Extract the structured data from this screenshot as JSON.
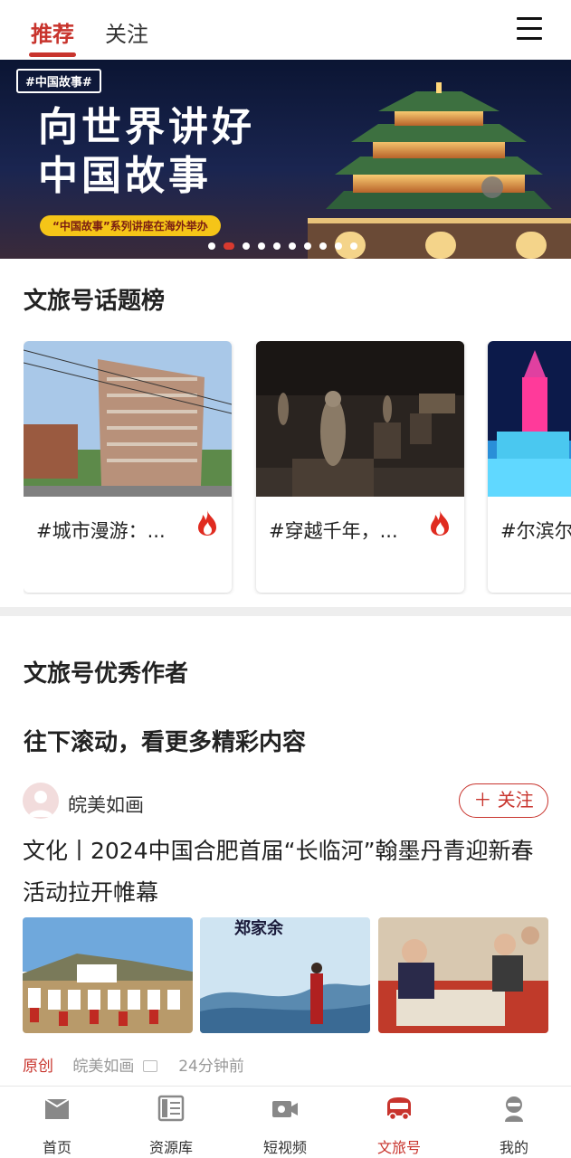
{
  "tabs": [
    {
      "label": "推荐",
      "active": true
    },
    {
      "label": "关注",
      "active": false
    }
  ],
  "banner": {
    "tag": "#中国故事#",
    "headline_line1": "向世界讲好",
    "headline_line2": "中国故事",
    "subtitle": "“中国故事”系列讲座在海外举办",
    "slide_count": 10,
    "active_slide": 2
  },
  "topic_section": {
    "title": "文旅号话题榜",
    "cards": [
      {
        "text": "#城市漫游：...",
        "icon": "fire-icon"
      },
      {
        "text": "#穿越千年，...",
        "icon": "fire-icon"
      },
      {
        "text": "#尔滨尔",
        "icon": "fire-icon"
      }
    ]
  },
  "authors_section": {
    "title": "文旅号优秀作者",
    "scroll_hint": "往下滚动，看更多精彩内容"
  },
  "article": {
    "author": "皖美如画",
    "follow_label": "＋ 关注",
    "title": "文化丨2024中国合肥首届“长临河”翰墨丹青迎新春活动拉开帷幕",
    "image_caption": "郑家余",
    "original_label": "原创",
    "source": "皖美如画",
    "time": "24分钟前"
  },
  "bottom_nav": [
    {
      "label": "首页",
      "icon": "home-icon",
      "active": false
    },
    {
      "label": "资源库",
      "icon": "library-icon",
      "active": false
    },
    {
      "label": "短视频",
      "icon": "video-camera-icon",
      "active": false
    },
    {
      "label": "文旅号",
      "icon": "bus-icon",
      "active": true
    },
    {
      "label": "我的",
      "icon": "user-icon",
      "active": false
    }
  ],
  "colors": {
    "accent": "#c8342d",
    "text_primary": "#222222",
    "text_muted": "#999999"
  }
}
